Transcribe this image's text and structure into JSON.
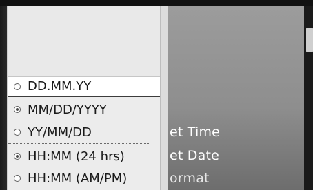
{
  "background_menu": {
    "items": [
      {
        "label": "et Time"
      },
      {
        "label": "et Date"
      },
      {
        "label": "ormat"
      }
    ]
  },
  "dropdown": {
    "items": [
      {
        "label": "DD.MM.YY",
        "selected": false
      },
      {
        "label": "MM/DD/YYYY",
        "selected": true
      },
      {
        "label": "YY/MM/DD",
        "selected": false
      },
      {
        "label": "HH:MM (24 hrs)",
        "selected": true
      },
      {
        "label": "HH:MM (AM/PM)",
        "selected": false
      }
    ]
  },
  "colors": {
    "panel_bg": "#e9e9e9",
    "highlight_bg": "#ffffff",
    "bg_menu": "#8e8e8e",
    "text": "#1a1a1a"
  },
  "icons": {
    "radio_unselected": "radio-empty-icon",
    "radio_selected": "radio-filled-icon"
  }
}
